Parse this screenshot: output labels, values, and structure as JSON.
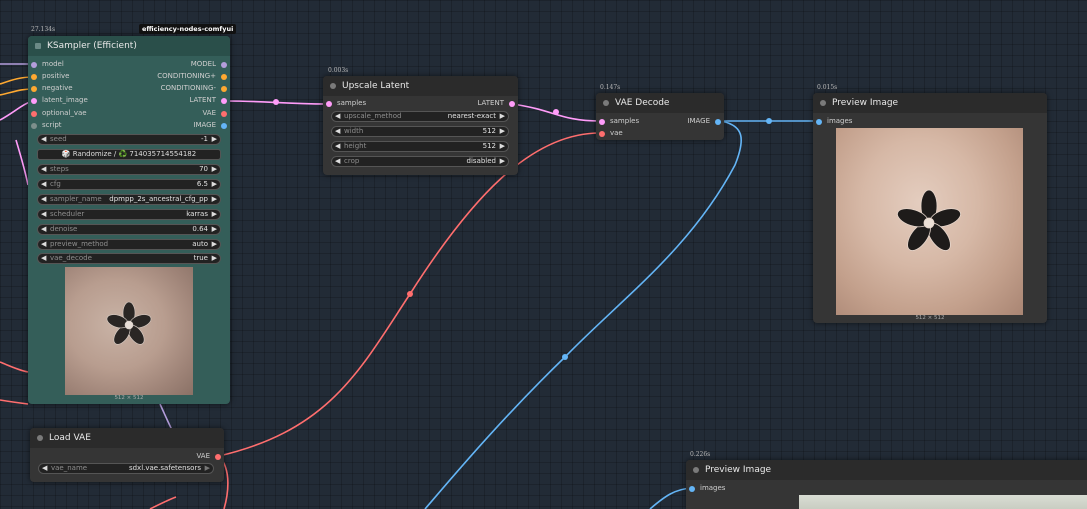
{
  "colors": {
    "canvas": "#222b36",
    "node_bg": "#353535",
    "ksampler_bg": "#345e59",
    "model": "#b39ddb",
    "conditioning": "#ffa931",
    "latent": "#ff9cf9",
    "vae": "#ff6e6e",
    "image": "#64b5f6"
  },
  "ksampler": {
    "timing": "27.134s",
    "badge": "efficiency-nodes-comfyui",
    "title": "KSampler (Efficient)",
    "inputs": [
      "model",
      "positive",
      "negative",
      "latent_image",
      "optional_vae",
      "script"
    ],
    "outputs": [
      "MODEL",
      "CONDITIONING+",
      "CONDITIONING-",
      "LATENT",
      "VAE",
      "IMAGE"
    ],
    "seed": {
      "name": "seed",
      "value": "-1"
    },
    "randomize_label": "🎲 Randomize / ♻️ 714035714554182",
    "widgets": [
      {
        "name": "steps",
        "value": "70"
      },
      {
        "name": "cfg",
        "value": "6.5"
      },
      {
        "name": "sampler_name",
        "value": "dpmpp_2s_ancestral_cfg_pp"
      },
      {
        "name": "scheduler",
        "value": "karras"
      },
      {
        "name": "denoise",
        "value": "0.64"
      },
      {
        "name": "preview_method",
        "value": "auto"
      },
      {
        "name": "vae_decode",
        "value": "true"
      }
    ],
    "image_size": "512 × 512"
  },
  "upscale_latent": {
    "timing": "0.003s",
    "title": "Upscale Latent",
    "input": "samples",
    "output": "LATENT",
    "widgets": [
      {
        "name": "upscale_method",
        "value": "nearest-exact"
      },
      {
        "name": "width",
        "value": "512"
      },
      {
        "name": "height",
        "value": "512"
      },
      {
        "name": "crop",
        "value": "disabled"
      }
    ]
  },
  "vae_decode": {
    "timing": "0.147s",
    "title": "VAE Decode",
    "inputs": [
      "samples",
      "vae"
    ],
    "output": "IMAGE"
  },
  "preview_image_1": {
    "timing": "0.015s",
    "title": "Preview Image",
    "input": "images",
    "image_size": "512 × 512"
  },
  "load_vae": {
    "title": "Load VAE",
    "output": "VAE",
    "widget": {
      "name": "vae_name",
      "value": "sdxl.vae.safetensors"
    }
  },
  "preview_image_2": {
    "timing": "0.226s",
    "title": "Preview Image",
    "input": "images"
  }
}
